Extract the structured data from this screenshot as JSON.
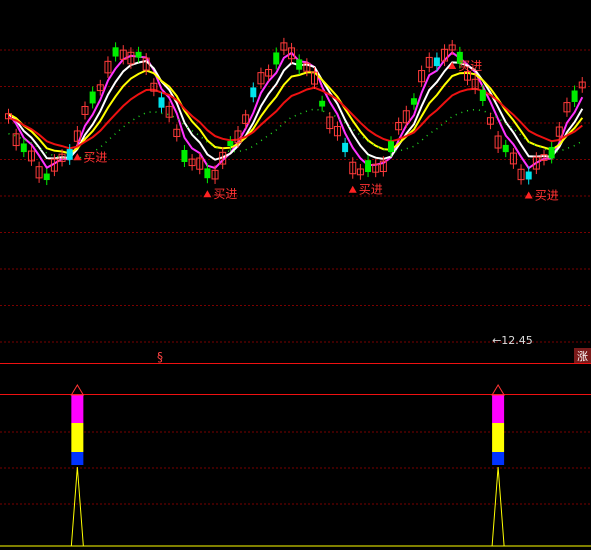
{
  "chart_data": [
    {
      "type": "candlestick",
      "panel": "price",
      "annotations": [
        {
          "text": "买进",
          "candle": 9
        },
        {
          "text": "买进",
          "candle": 26
        },
        {
          "text": "买进",
          "candle": 45
        },
        {
          "text": "买进",
          "candle": 58
        },
        {
          "text": "买进",
          "candle": 68
        }
      ],
      "low_marker": {
        "text": "←12.45",
        "candle": 64,
        "value": 12.45
      },
      "corner_badge": "涨",
      "divider_glyph": "§",
      "series_colors": {
        "up": "#ff3b3b",
        "down_solid": "#00ee00",
        "down_cyan": "#00e5ee",
        "ma_white": "#ffffff",
        "ma_yellow": "#ffff00",
        "ma_magenta": "#ff33ff",
        "ma_red": "#ee1111",
        "ma_dotted": "#22dd22",
        "gridline": "#7a0000"
      }
    },
    {
      "type": "signal",
      "panel": "indicator",
      "signal_candles": [
        9,
        64
      ],
      "signal_colors": [
        "#ff00ff",
        "#ffff00",
        "#0033ff"
      ]
    }
  ]
}
